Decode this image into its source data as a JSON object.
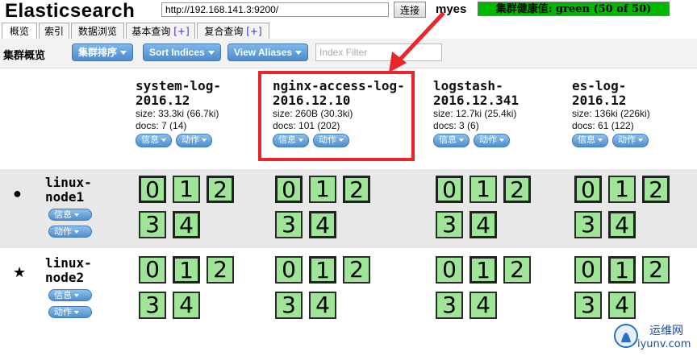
{
  "header": {
    "logo": "Elasticsearch",
    "url_value": "http://192.168.141.3:9200/",
    "connect_label": "连接",
    "cluster_name": "myes",
    "health_text": "集群健康值: green (50 of 50)",
    "health_color": "#00b800"
  },
  "tabs": [
    {
      "label": "概览",
      "plus": ""
    },
    {
      "label": "索引",
      "plus": ""
    },
    {
      "label": "数据浏览",
      "plus": ""
    },
    {
      "label": "基本查询",
      "plus": "[+]"
    },
    {
      "label": "复合查询",
      "plus": "[+]"
    }
  ],
  "toolbar": {
    "title": "集群概览",
    "sort_label": "集群排序",
    "sort_indices_label": "Sort Indices",
    "view_aliases_label": "View Aliases",
    "filter_placeholder": "Index Filter"
  },
  "common": {
    "info_label": "信息",
    "action_label": "动作"
  },
  "indices": [
    {
      "name_line1": "system-log-",
      "name_line2": "2016.12",
      "size": "size: 33.3ki (66.7ki)",
      "docs": "docs: 7 (14)"
    },
    {
      "name_line1": "nginx-access-log-",
      "name_line2": "2016.12.10",
      "size": "size: 260B (30.3ki)",
      "docs": "docs: 101 (202)"
    },
    {
      "name_line1": "logstash-",
      "name_line2": "2016.12.341",
      "size": "size: 12.7ki (25.4ki)",
      "docs": "docs: 3 (6)"
    },
    {
      "name_line1": "es-log-",
      "name_line2": "2016.12",
      "size": "size: 136ki (226ki)",
      "docs": "docs: 61 (122)"
    }
  ],
  "nodes": [
    {
      "marker": "●",
      "name_line1": "linux-",
      "name_line2": "node1"
    },
    {
      "marker": "★",
      "name_line1": "linux-",
      "name_line2": "node2"
    }
  ],
  "shards": {
    "labels": [
      "0",
      "1",
      "2",
      "3",
      "4"
    ],
    "color": "#9ee597"
  },
  "watermark": {
    "line1": "运维网",
    "line2": "iyunv.com"
  }
}
